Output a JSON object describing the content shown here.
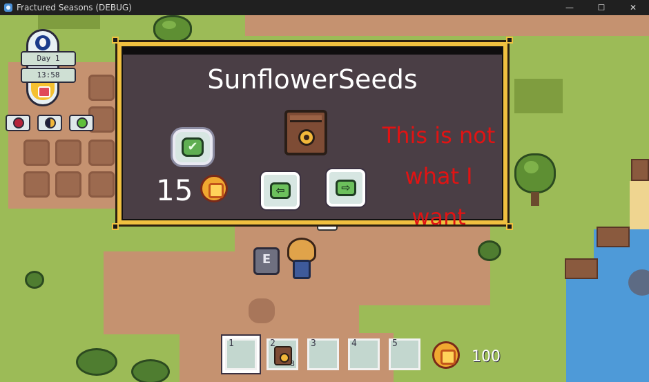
{
  "window": {
    "title": "Fractured Seasons (DEBUG)",
    "minimize_glyph": "—",
    "maximize_glyph": "☐",
    "close_glyph": "✕"
  },
  "hud": {
    "day_label": "Day 1",
    "time_label": "13:58",
    "status_icons": [
      "red-orb-icon",
      "moon-phase-icon",
      "green-orb-icon"
    ]
  },
  "shop_dialog": {
    "item_name": "SunflowerSeeds",
    "item_icon": "seed-bag-icon",
    "confirm_glyph": "✔",
    "price": "15",
    "prev_glyph": "⇦",
    "next_glyph": "⇨"
  },
  "annotation": {
    "line1": "This is not",
    "line2": "what I",
    "line3": "want"
  },
  "interact_key": "E",
  "hotbar": {
    "slots": [
      {
        "number": "1",
        "item": "",
        "count": ""
      },
      {
        "number": "2",
        "item": "seed-bag-icon",
        "count": "3"
      },
      {
        "number": "3",
        "item": "",
        "count": ""
      },
      {
        "number": "4",
        "item": "",
        "count": ""
      },
      {
        "number": "5",
        "item": "",
        "count": ""
      }
    ],
    "selected_slot": 1,
    "money": "100"
  }
}
